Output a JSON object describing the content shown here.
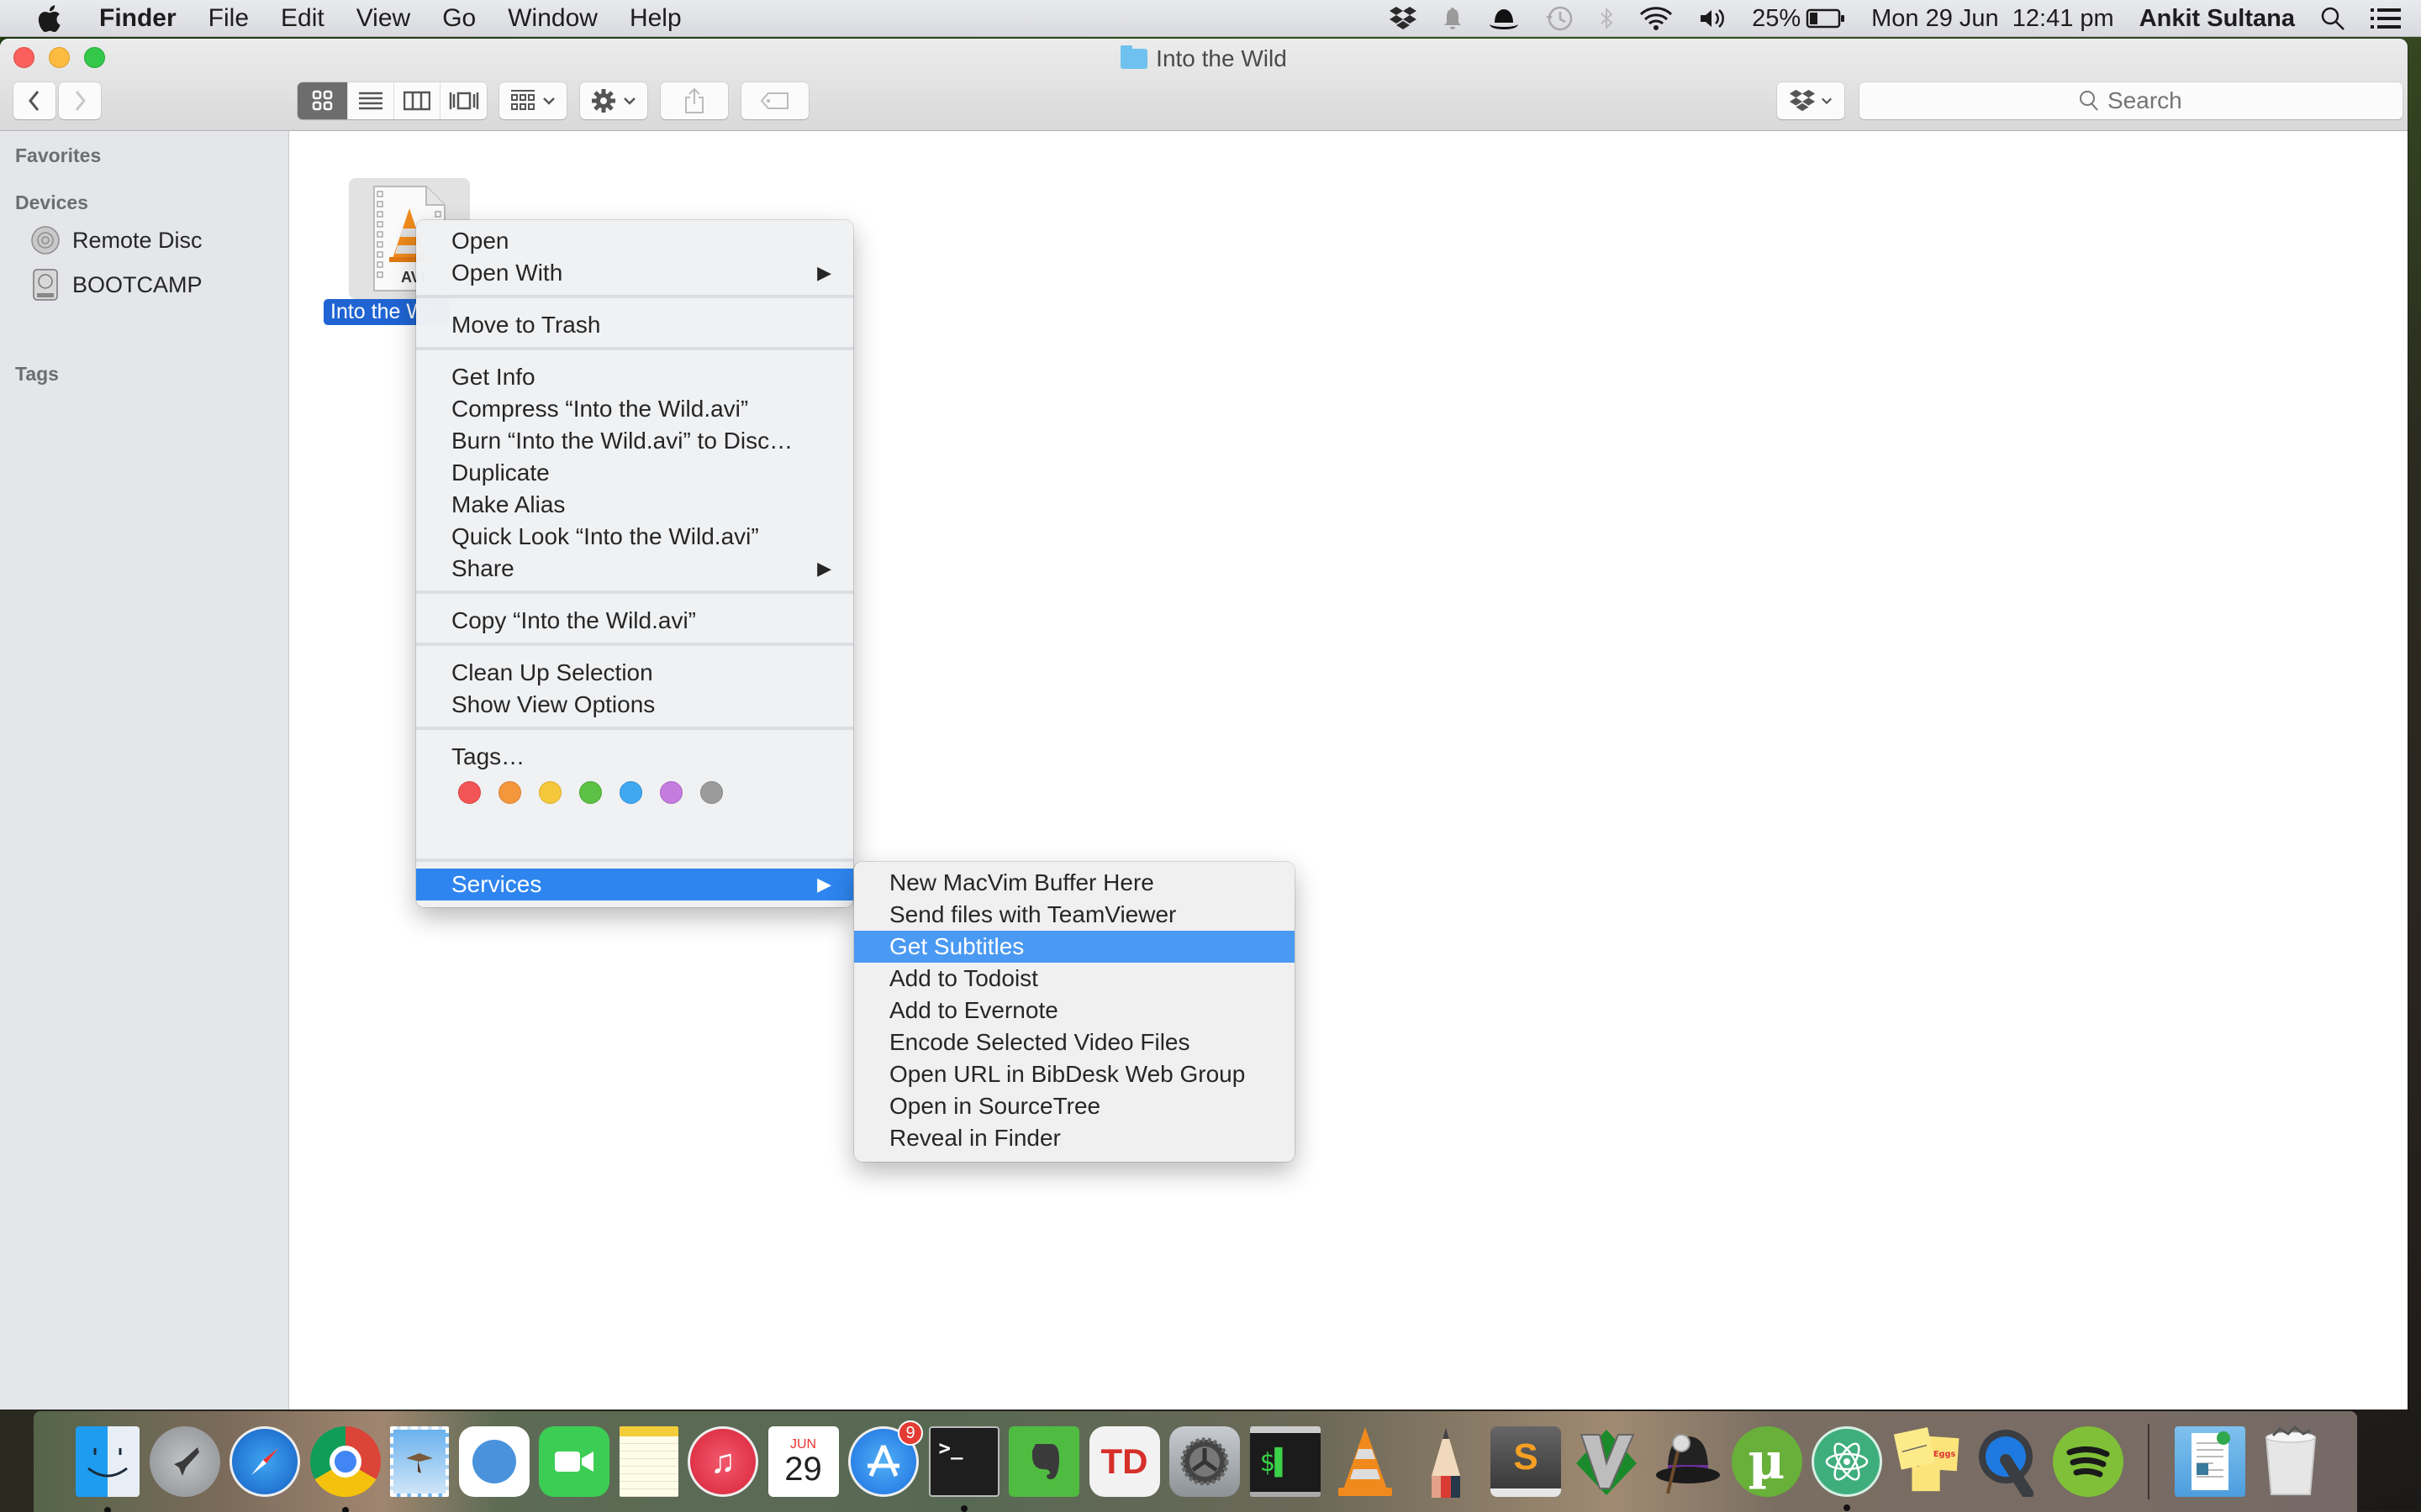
{
  "menubar": {
    "app_name": "Finder",
    "menus": [
      "File",
      "Edit",
      "View",
      "Go",
      "Window",
      "Help"
    ],
    "status_icons": [
      "dropbox-icon",
      "notification-bell-icon",
      "bowler-hat-icon",
      "time-machine-icon",
      "bluetooth-icon",
      "wifi-icon",
      "volume-icon"
    ],
    "battery_percent": "25%",
    "datetime": "Mon 29 Jun  12:41 pm",
    "user": "Ankit Sultana"
  },
  "window": {
    "title": "Into the Wild",
    "search_placeholder": "Search",
    "view_modes": [
      "icon",
      "list",
      "column",
      "cover-flow"
    ],
    "active_view": "icon"
  },
  "sidebar": {
    "favorites_label": "Favorites",
    "devices_label": "Devices",
    "devices": [
      {
        "label": "Remote Disc",
        "icon": "remote-disc-icon"
      },
      {
        "label": "BOOTCAMP",
        "icon": "hard-drive-icon"
      }
    ],
    "tags_label": "Tags"
  },
  "file": {
    "name_visible": "Into the W",
    "full_name": "Into the Wild.avi",
    "type_label": "AVI"
  },
  "context_menu": {
    "items": [
      {
        "label": "Open"
      },
      {
        "label": "Open With",
        "submenu": true
      },
      {
        "label": "Move to Trash"
      },
      {
        "label": "Get Info"
      },
      {
        "label": "Compress “Into the Wild.avi”"
      },
      {
        "label": "Burn “Into the Wild.avi” to Disc…"
      },
      {
        "label": "Duplicate"
      },
      {
        "label": "Make Alias"
      },
      {
        "label": "Quick Look “Into the Wild.avi”"
      },
      {
        "label": "Share",
        "submenu": true
      },
      {
        "label": "Copy “Into the Wild.avi”"
      },
      {
        "label": "Clean Up Selection"
      },
      {
        "label": "Show View Options"
      },
      {
        "label": "Tags…"
      },
      {
        "label": "Services",
        "submenu": true,
        "highlighted": true
      }
    ],
    "tag_colors": [
      {
        "name": "red",
        "color": "#f25555"
      },
      {
        "name": "orange",
        "color": "#f4963c"
      },
      {
        "name": "yellow",
        "color": "#f4c83a"
      },
      {
        "name": "green",
        "color": "#5cc145"
      },
      {
        "name": "blue",
        "color": "#3fa8f0"
      },
      {
        "name": "purple",
        "color": "#c47dde"
      },
      {
        "name": "gray",
        "color": "#9b9b9b"
      }
    ]
  },
  "services_menu": {
    "items": [
      {
        "label": "New MacVim Buffer Here"
      },
      {
        "label": "Send files with TeamViewer"
      },
      {
        "label": "Get Subtitles",
        "highlighted": true
      },
      {
        "label": "Add to Todoist"
      },
      {
        "label": "Add to Evernote"
      },
      {
        "label": "Encode Selected Video Files"
      },
      {
        "label": "Open URL in BibDesk Web Group"
      },
      {
        "label": "Open in SourceTree"
      },
      {
        "label": "Reveal in Finder"
      }
    ]
  },
  "dock": {
    "apps": [
      {
        "name": "Finder",
        "running": true
      },
      {
        "name": "Launchpad"
      },
      {
        "name": "Safari"
      },
      {
        "name": "Google Chrome",
        "running": true
      },
      {
        "name": "Mail"
      },
      {
        "name": "Simplenote"
      },
      {
        "name": "FaceTime"
      },
      {
        "name": "Notes"
      },
      {
        "name": "iTunes"
      },
      {
        "name": "Calendar",
        "month": "JUN",
        "day": "29"
      },
      {
        "name": "App Store",
        "badge": "9"
      },
      {
        "name": "Terminal",
        "running": true
      },
      {
        "name": "Evernote"
      },
      {
        "name": "Todoist"
      },
      {
        "name": "System Preferences"
      },
      {
        "name": "iTerm"
      },
      {
        "name": "VLC"
      },
      {
        "name": "Pencil"
      },
      {
        "name": "Sublime Text"
      },
      {
        "name": "MacVim"
      },
      {
        "name": "Alfred"
      },
      {
        "name": "uTorrent"
      },
      {
        "name": "Atom",
        "running": true
      },
      {
        "name": "Stickies"
      },
      {
        "name": "QuickTime Player"
      },
      {
        "name": "Spotify"
      },
      {
        "name": "Documents"
      },
      {
        "name": "Trash"
      }
    ]
  }
}
